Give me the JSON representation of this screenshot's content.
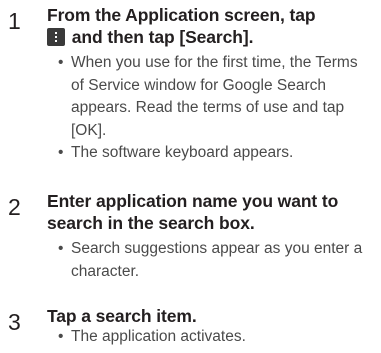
{
  "steps": [
    {
      "number": "1",
      "title_before_icon": "From the Application screen, tap",
      "icon": "menu-key-icon",
      "title_after_icon": "and then tap [Search].",
      "bullets": [
        "When you use for the first time, the Terms of Service window for Google Search appears. Read the terms of use and tap [OK].",
        "The software keyboard appears."
      ]
    },
    {
      "number": "2",
      "title": "Enter application name you want to search in the search box.",
      "bullets": [
        "Search suggestions appear as you enter a character."
      ]
    },
    {
      "number": "3",
      "title": "Tap a search item.",
      "bullets": [
        "The application activates."
      ]
    }
  ],
  "bullet_glyph": "•"
}
